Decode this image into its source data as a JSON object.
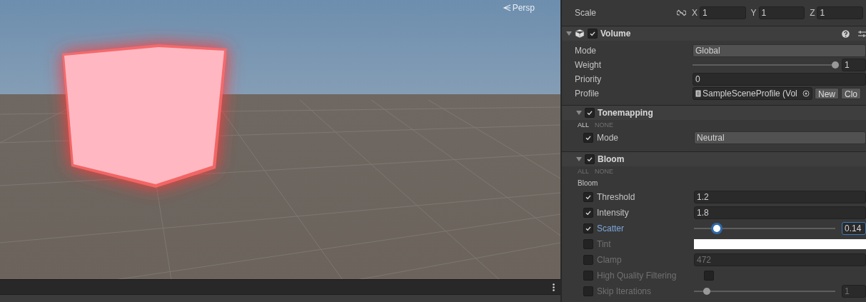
{
  "scene_view": {
    "projection_label": "Persp"
  },
  "inspector": {
    "scale_row": {
      "label": "Scale",
      "fields": [
        {
          "axis": "X",
          "value": "1"
        },
        {
          "axis": "Y",
          "value": "1"
        },
        {
          "axis": "Z",
          "value": "1"
        }
      ]
    },
    "volume": {
      "title": "Volume",
      "enabled": true,
      "properties": [
        {
          "kind": "dropdown",
          "label": "Mode",
          "value": "Global"
        },
        {
          "kind": "slider",
          "label": "Weight",
          "level": 1.0,
          "value": "1"
        },
        {
          "kind": "field",
          "label": "Priority",
          "value": "0"
        },
        {
          "kind": "object",
          "label": "Profile",
          "value": "SampleSceneProfile (Vol",
          "buttons": [
            "New",
            "Clo"
          ]
        }
      ]
    },
    "overrides": [
      {
        "title": "Tonemapping",
        "enabled": true,
        "toggles": [
          {
            "label": "ALL",
            "active": true
          },
          {
            "label": "NONE",
            "active": false
          }
        ],
        "properties": [
          {
            "kind": "dropdown",
            "label": "Mode",
            "override": true,
            "focused": false,
            "value": "Neutral"
          }
        ]
      },
      {
        "title": "Bloom",
        "enabled": true,
        "toggles": [
          {
            "label": "ALL",
            "active": false
          },
          {
            "label": "NONE",
            "active": false
          }
        ],
        "group_label": "Bloom",
        "properties": [
          {
            "kind": "field",
            "label": "Threshold",
            "override": true,
            "focused": false,
            "value": "1.2"
          },
          {
            "kind": "field",
            "label": "Intensity",
            "override": true,
            "focused": false,
            "value": "1.8"
          },
          {
            "kind": "slider",
            "label": "Scatter",
            "override": true,
            "focused": true,
            "level": 0.16,
            "value": "0.14"
          },
          {
            "kind": "color",
            "label": "Tint",
            "override": false,
            "focused": false,
            "color": "#ffffff"
          },
          {
            "kind": "field",
            "label": "Clamp",
            "override": false,
            "focused": false,
            "value": "472"
          },
          {
            "kind": "toggle",
            "label": "High Quality Filtering",
            "override": false,
            "focused": false,
            "checked": false
          },
          {
            "kind": "slider",
            "label": "Skip Iterations",
            "override": false,
            "focused": false,
            "level": 0.09,
            "value": "1"
          }
        ]
      }
    ]
  }
}
